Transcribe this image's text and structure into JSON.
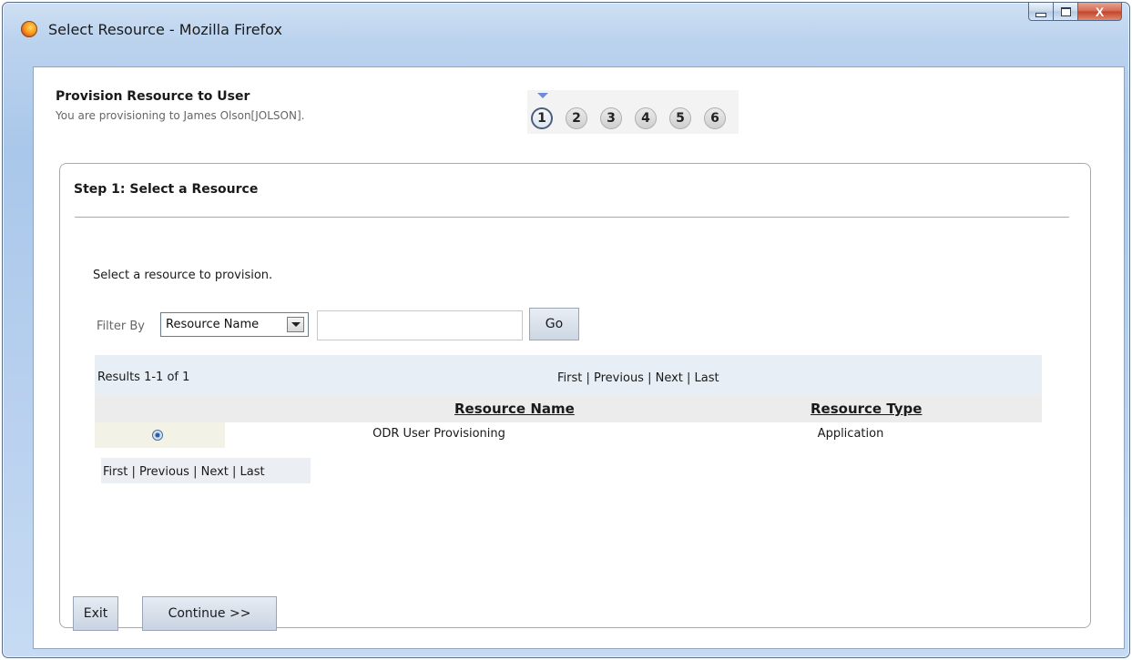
{
  "window": {
    "title": "Select Resource - Mozilla Firefox",
    "controls": {
      "minimize_icon": "minimize-icon",
      "maximize_icon": "maximize-icon",
      "close_icon": "close-icon",
      "close_glyph": "X"
    }
  },
  "header": {
    "title": "Provision Resource to User",
    "subtitle": "You are provisioning to James Olson[JOLSON]."
  },
  "train": {
    "current_step": 1,
    "steps": [
      "1",
      "2",
      "3",
      "4",
      "5",
      "6"
    ]
  },
  "step": {
    "title": "Step 1: Select a Resource",
    "instruction": "Select a resource to provision."
  },
  "filter": {
    "label": "Filter By",
    "selected_option": "Resource Name",
    "input_value": "",
    "go_label": "Go"
  },
  "results": {
    "count_text": "Results 1-1 of 1",
    "pager": {
      "first": "First ",
      "previous": "| Previous ",
      "next": "| Next ",
      "last": "| Last"
    },
    "columns": [
      "Resource Name ",
      "Resource Type "
    ],
    "rows": [
      {
        "selected": true,
        "resource_name": "ODR User Provisioning",
        "resource_type": "Application"
      }
    ]
  },
  "buttons": {
    "exit": "Exit",
    "continue": "Continue >>"
  }
}
